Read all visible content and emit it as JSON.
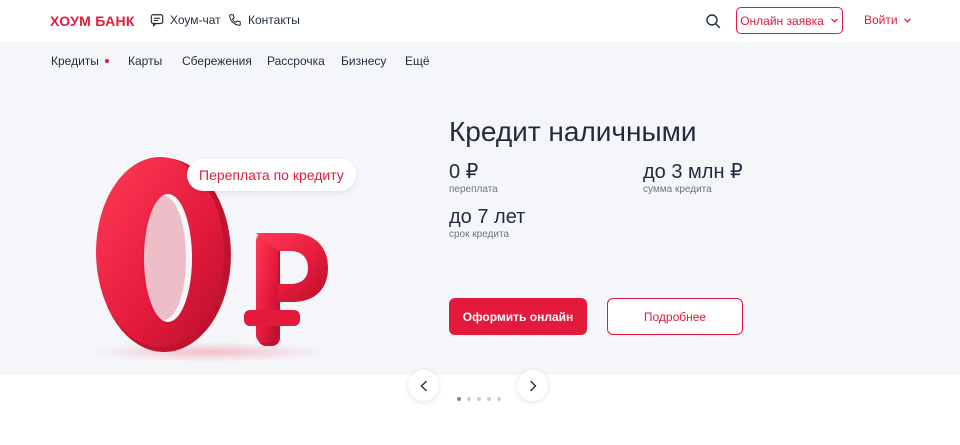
{
  "header": {
    "logo": "ХОУМ БАНК",
    "chat_label": "Хоум-чат",
    "contacts_label": "Контакты",
    "apply_label": "Онлайн заявка",
    "login_label": "Войти"
  },
  "nav": {
    "items": [
      {
        "label": "Кредиты",
        "active": true
      },
      {
        "label": "Карты"
      },
      {
        "label": "Сбережения"
      },
      {
        "label": "Рассрочка"
      },
      {
        "label": "Бизнесу"
      },
      {
        "label": "Ещё"
      }
    ]
  },
  "hero": {
    "bubble_text": "Переплата по кредиту",
    "art_text": "0₽",
    "title": "Кредит наличными",
    "stats": [
      {
        "value": "0 ₽",
        "label": "переплата"
      },
      {
        "value": "до 3 млн ₽",
        "label": "сумма кредита"
      },
      {
        "value": "до 7 лет",
        "label": "срок кредита"
      }
    ],
    "primary_button": "Оформить онлайн",
    "secondary_button": "Подробнее"
  },
  "slider": {
    "total": 5,
    "current": 1
  },
  "colors": {
    "brand": "#e31a3c",
    "text": "#1f2c3d",
    "hero_bg": "#f5f6fa"
  }
}
